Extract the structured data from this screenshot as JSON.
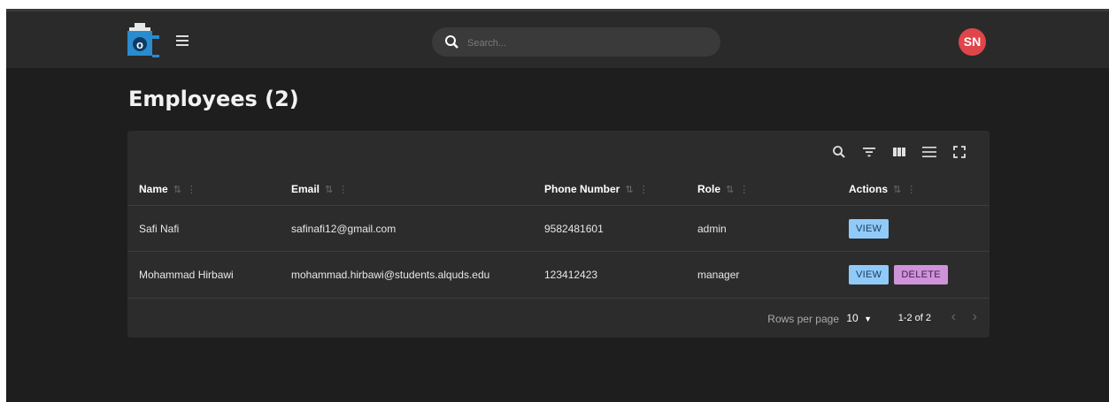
{
  "header": {
    "search_placeholder": "Search...",
    "avatar_initials": "SN",
    "avatar_color": "#e0454a"
  },
  "page": {
    "title": "Employees (2)"
  },
  "table": {
    "columns": [
      "Name",
      "Email",
      "Phone Number",
      "Role",
      "Actions"
    ],
    "rows": [
      {
        "name": "Safi Nafi",
        "email": "safinafi12@gmail.com",
        "phone": "9582481601",
        "role": "admin",
        "actions": [
          "VIEW"
        ]
      },
      {
        "name": "Mohammad Hirbawi",
        "email": "mohammad.hirbawi@students.alquds.edu",
        "phone": "123412423",
        "role": "manager",
        "actions": [
          "VIEW",
          "DELETE"
        ]
      }
    ],
    "sort_glyph": "⇅",
    "menu_glyph": "⋮"
  },
  "footer": {
    "rows_per_page_label": "Rows per page",
    "rows_per_page_value": "10",
    "range": "1-2 of 2"
  },
  "icons": {
    "toolbar": [
      "search-icon",
      "filter-icon",
      "columns-icon",
      "density-icon",
      "fullscreen-icon"
    ],
    "nav": [
      "chevron-left-icon",
      "chevron-right-icon"
    ]
  },
  "colors": {
    "view_button": "#90caf9",
    "delete_button": "#ce93d8"
  }
}
